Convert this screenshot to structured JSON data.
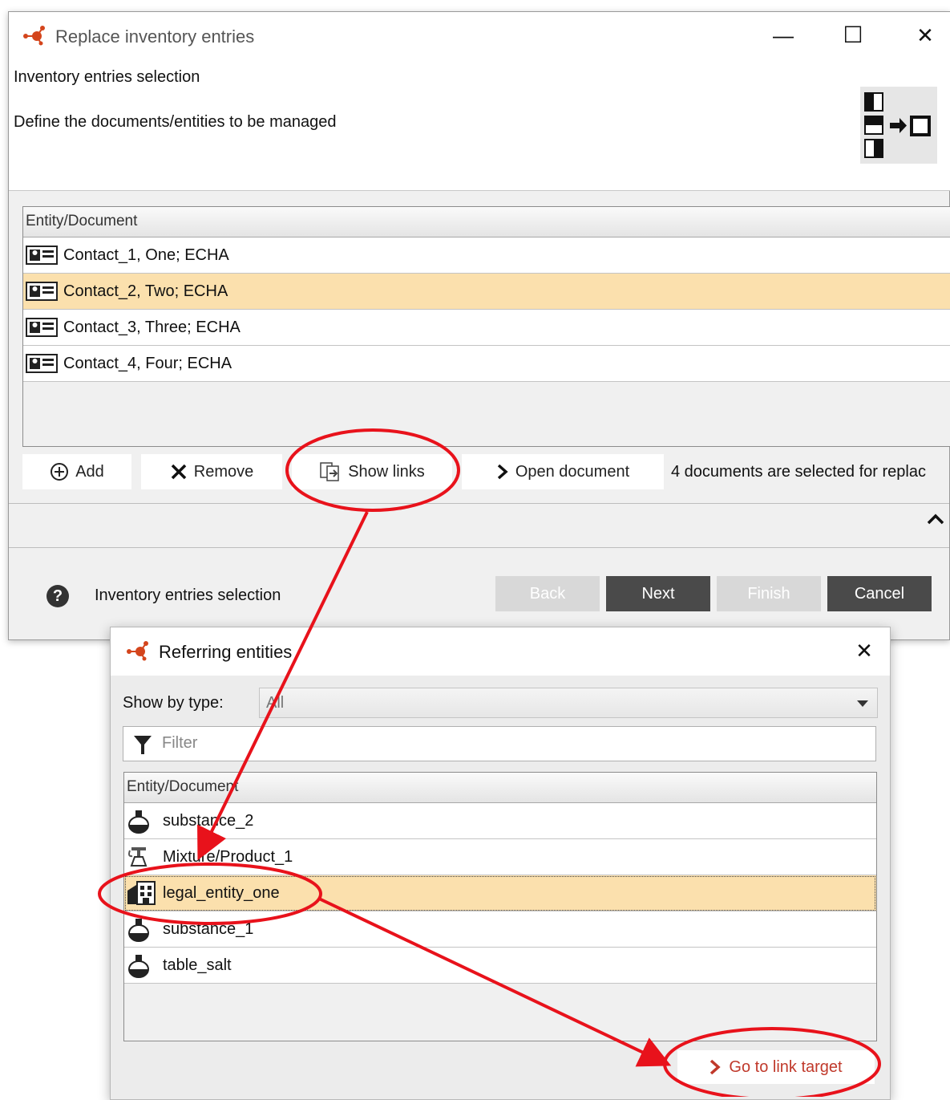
{
  "main_window": {
    "title": "Replace inventory entries",
    "controls": {
      "minimize": "—",
      "maximize": "☐",
      "close": "✕"
    },
    "heading": "Inventory entries selection",
    "description": "Define the documents/entities to be managed",
    "table": {
      "column_header": "Entity/Document",
      "rows": [
        {
          "label": "Contact_1, One; ECHA",
          "selected": false
        },
        {
          "label": "Contact_2, Two; ECHA",
          "selected": true
        },
        {
          "label": "Contact_3, Three; ECHA",
          "selected": false
        },
        {
          "label": "Contact_4, Four; ECHA",
          "selected": false
        }
      ]
    },
    "toolbar": {
      "add": "Add",
      "remove": "Remove",
      "show_links": "Show links",
      "open_document": "Open document",
      "status": "4 documents are selected for replac"
    },
    "footer": {
      "help_label": "Inventory entries selection",
      "back": "Back",
      "next": "Next",
      "finish": "Finish",
      "cancel": "Cancel"
    }
  },
  "dialog": {
    "title": "Referring entities",
    "close": "✕",
    "show_by_type_label": "Show by type:",
    "show_by_type_value": "All",
    "filter_placeholder": "Filter",
    "table": {
      "column_header": "Entity/Document",
      "rows": [
        {
          "label": "substance_2",
          "icon": "flask-icon",
          "selected": false
        },
        {
          "label": "Mixture/Product_1",
          "icon": "mixture-icon",
          "selected": false
        },
        {
          "label": "legal_entity_one",
          "icon": "legal-entity-icon",
          "selected": true
        },
        {
          "label": "substance_1",
          "icon": "flask-icon",
          "selected": false
        },
        {
          "label": "table_salt",
          "icon": "flask-icon",
          "selected": false
        }
      ]
    },
    "go_to_link_target": "Go to link target"
  },
  "colors": {
    "selection": "#fbe0ad",
    "annotation": "#e8121b",
    "dark_button": "#4a4a4a",
    "disabled_button": "#d8d8d8"
  }
}
